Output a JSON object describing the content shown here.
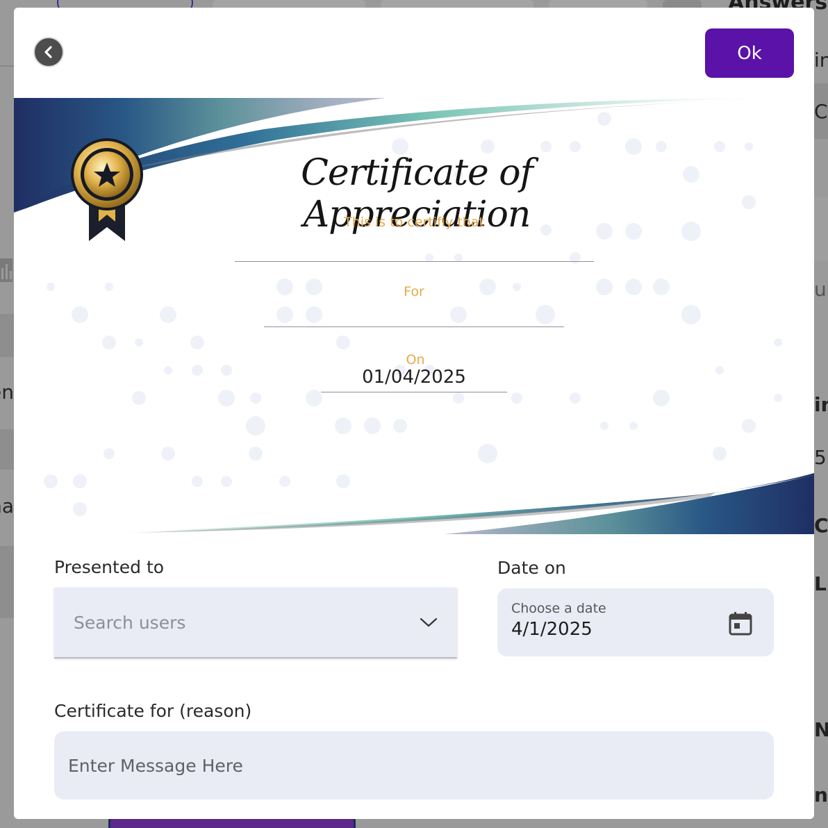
{
  "background": {
    "heading_fragment": "Answers",
    "left_fragments": [
      "en",
      "na"
    ],
    "right_fragments": [
      "in",
      "Co",
      "ur",
      "in",
      "5",
      "C",
      "L",
      "N",
      "ng"
    ]
  },
  "modal": {
    "ok_label": "Ok",
    "certificate": {
      "title": "Certificate of Appreciation",
      "subtitle": "This is to certifiy that",
      "for_label": "For",
      "on_label": "On",
      "date": "01/04/2025"
    },
    "form": {
      "presented_to_label": "Presented to",
      "presented_to_placeholder": "Search users",
      "date_on_label": "Date on",
      "date_caption": "Choose a date",
      "date_value": "4/1/2025",
      "reason_label": "Certificate for (reason)",
      "reason_placeholder": "Enter Message Here"
    },
    "colors": {
      "ok_button": "#5a12a8",
      "accent_text": "#e6a94b",
      "wave_navy": "#1f2f63",
      "wave_teal": "#7cc6b6",
      "field_bg": "#e9ecf4"
    },
    "icons": [
      "chevron-left-icon",
      "medal-icon",
      "chevron-down-icon",
      "calendar-icon"
    ]
  }
}
